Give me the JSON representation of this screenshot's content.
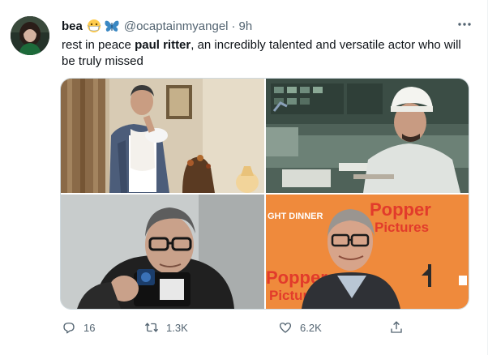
{
  "tweet": {
    "display_name": "bea",
    "emoji": [
      "face-with-mask-emoji",
      "blue-butterfly-emoji"
    ],
    "handle": "@ocaptainmyangel",
    "separator": "·",
    "time": "9h",
    "text_before": "rest in peace ",
    "text_bold": "paul ritter",
    "text_after": ", an incredibly talented and versatile actor who will be truly missed",
    "photo_texts": {
      "poster_left": "GHT DINNER",
      "poster_right": "Popper Pictures"
    }
  },
  "actions": {
    "reply_count": "16",
    "retweet_count": "1.3K",
    "like_count": "6.2K"
  },
  "icons": {
    "more": "more-horizontal-icon",
    "reply": "reply-icon",
    "retweet": "retweet-icon",
    "like": "heart-icon",
    "share": "share-icon"
  },
  "colors": {
    "text": "#0f1419",
    "secondary": "#536471",
    "border": "#cfd9de",
    "poster_orange": "#ef8a3c",
    "poster_red": "#e23b2b"
  }
}
